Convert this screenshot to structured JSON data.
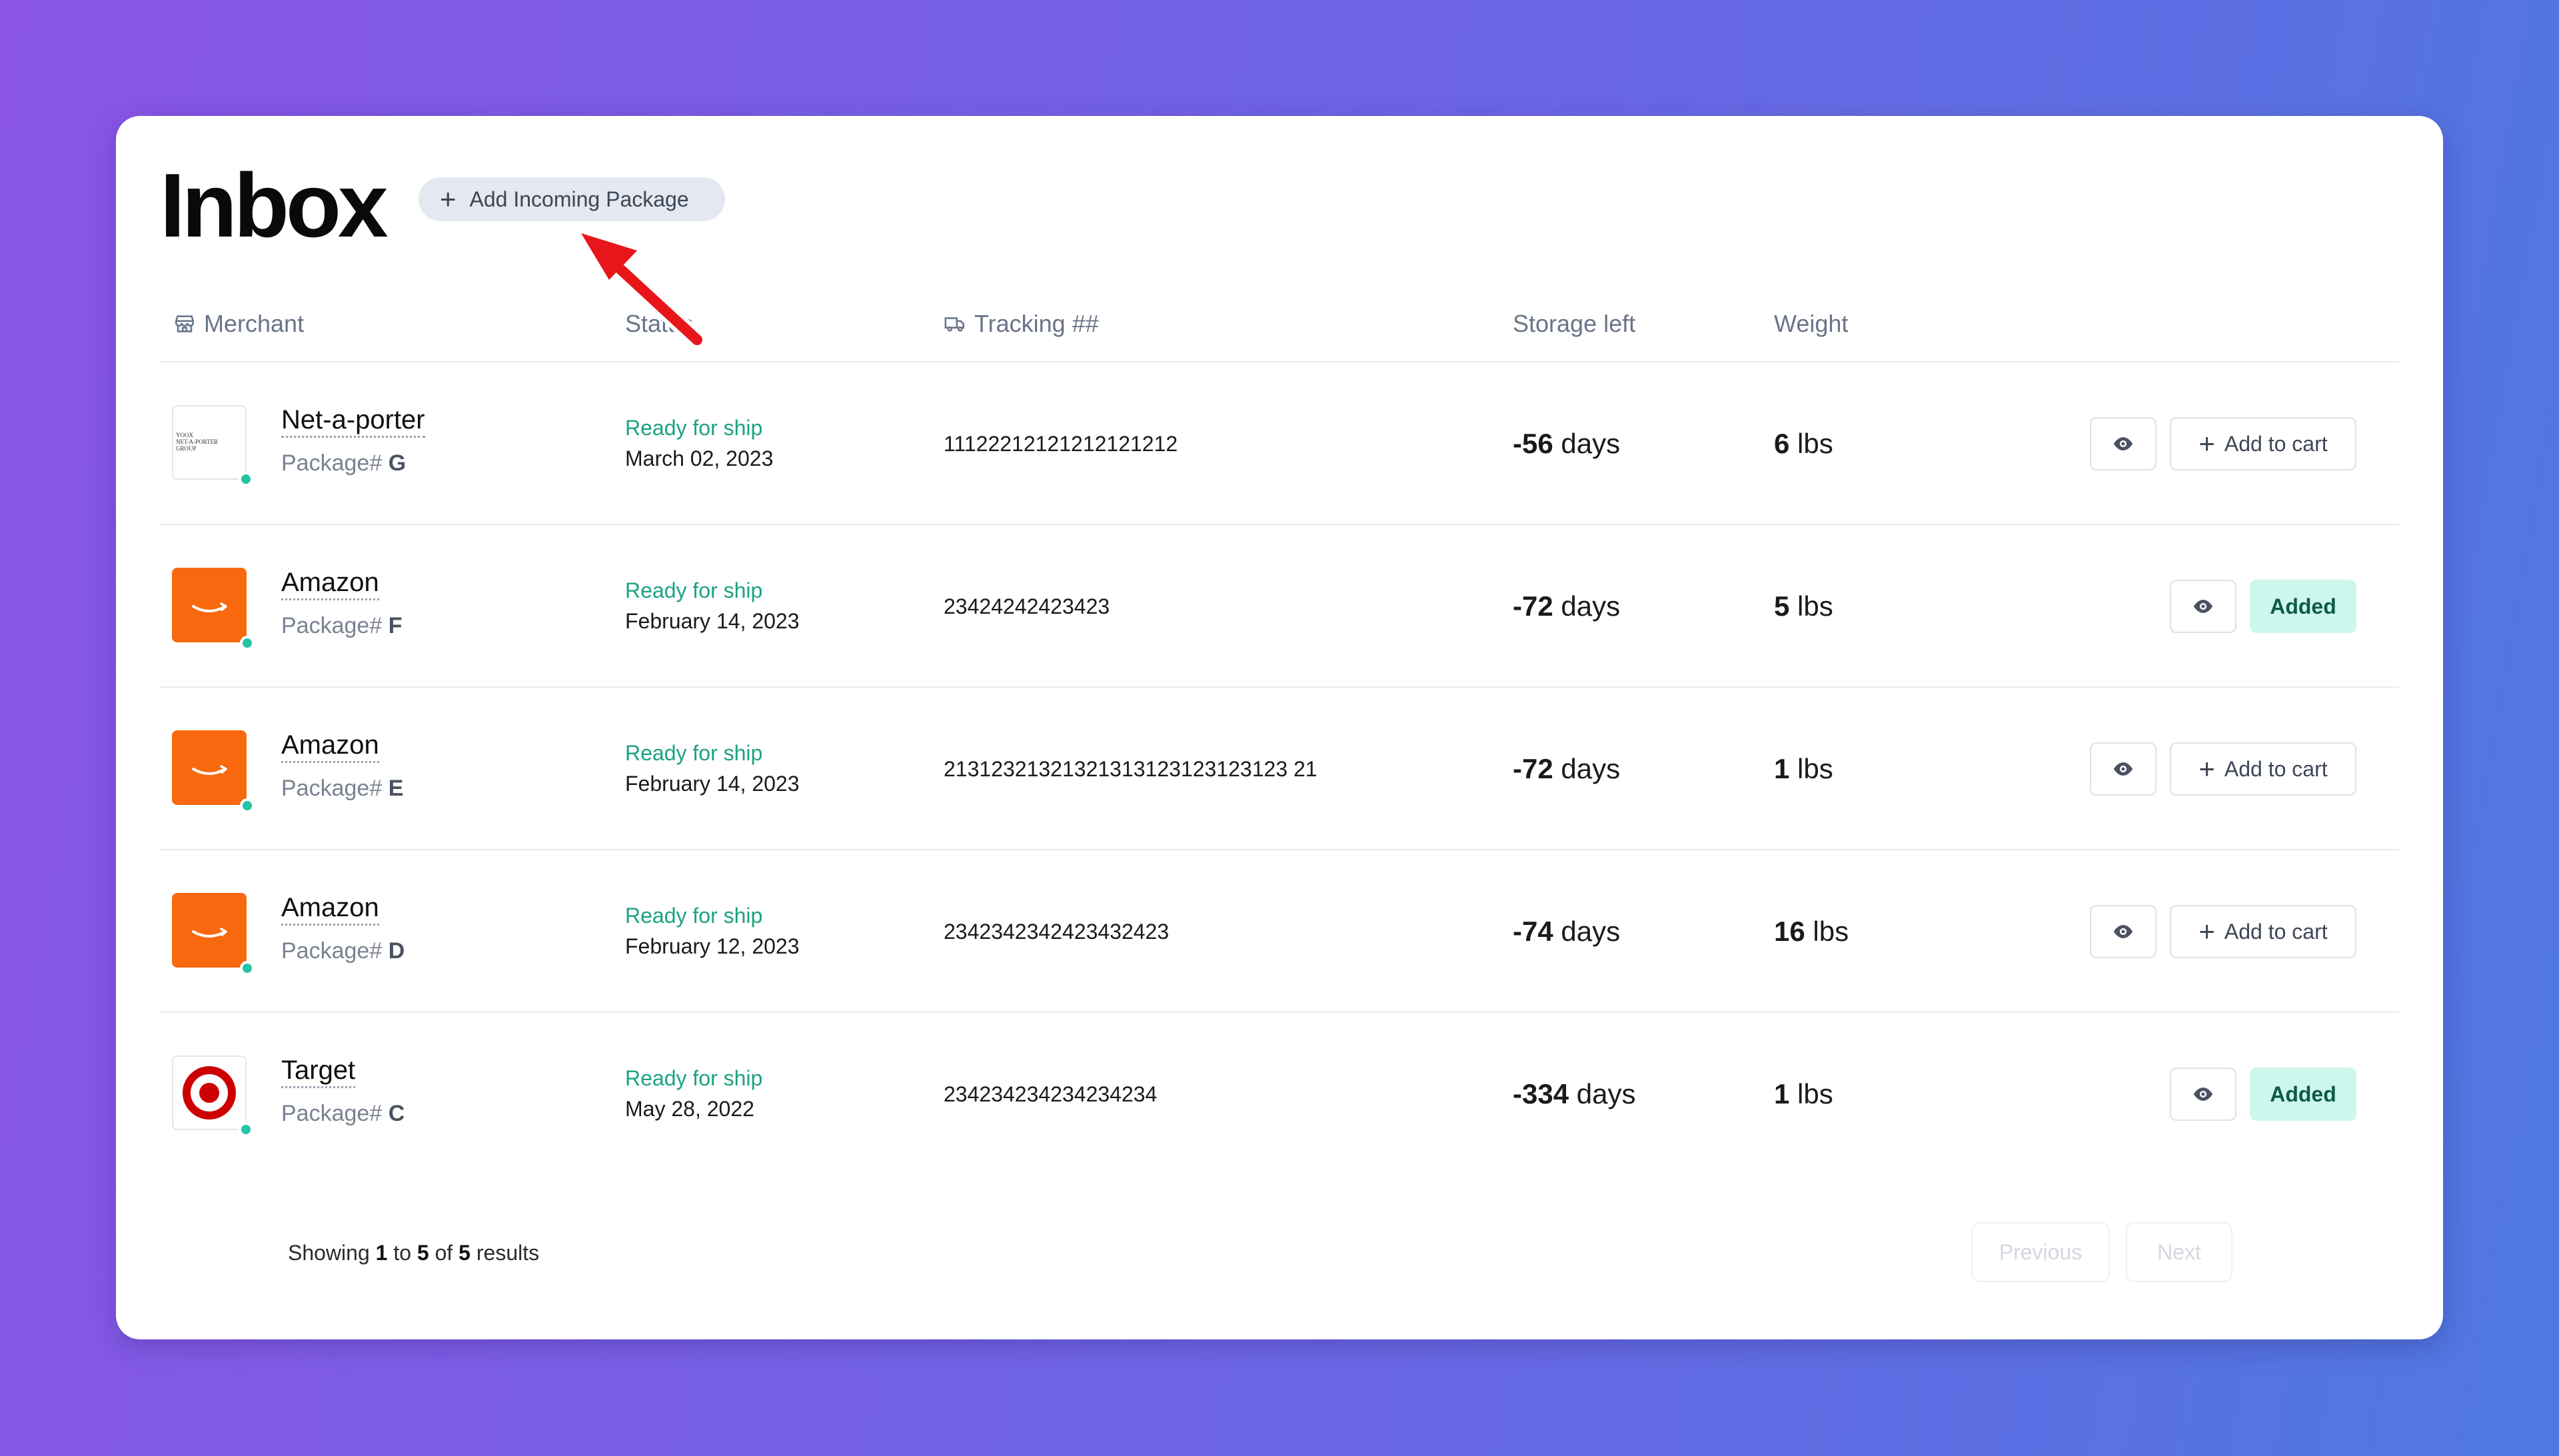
{
  "page": {
    "title": "Inbox",
    "add_incoming_label": "Add Incoming Package"
  },
  "table": {
    "headers": {
      "merchant": "Merchant",
      "status": "Status",
      "tracking": "Tracking ##",
      "storage": "Storage left",
      "weight": "Weight"
    },
    "rows": [
      {
        "merchant": "Net-a-porter",
        "logo": "netaporter-logo",
        "package_prefix": "Package#",
        "package_id": "G",
        "status": "Ready for ship",
        "date": "March 02, 2023",
        "tracking": "11122212121212121212",
        "storage_value": "-56",
        "storage_unit": "days",
        "weight_value": "6",
        "weight_unit": "lbs",
        "action": "add",
        "action_label": "Add to cart"
      },
      {
        "merchant": "Amazon",
        "logo": "amazon-logo",
        "package_prefix": "Package#",
        "package_id": "F",
        "status": "Ready for ship",
        "date": "February 14, 2023",
        "tracking": "23424242423423",
        "storage_value": "-72",
        "storage_unit": "days",
        "weight_value": "5",
        "weight_unit": "lbs",
        "action": "added",
        "action_label": "Added"
      },
      {
        "merchant": "Amazon",
        "logo": "amazon-logo",
        "package_prefix": "Package#",
        "package_id": "E",
        "status": "Ready for ship",
        "date": "February 14, 2023",
        "tracking": "21312321321321313123123123123 21",
        "storage_value": "-72",
        "storage_unit": "days",
        "weight_value": "1",
        "weight_unit": "lbs",
        "action": "add",
        "action_label": "Add to cart"
      },
      {
        "merchant": "Amazon",
        "logo": "amazon-logo",
        "package_prefix": "Package#",
        "package_id": "D",
        "status": "Ready for ship",
        "date": "February 12, 2023",
        "tracking": "2342342342423432423",
        "storage_value": "-74",
        "storage_unit": "days",
        "weight_value": "16",
        "weight_unit": "lbs",
        "action": "add",
        "action_label": "Add to cart"
      },
      {
        "merchant": "Target",
        "logo": "target-logo",
        "package_prefix": "Package#",
        "package_id": "C",
        "status": "Ready for ship",
        "date": "May 28, 2022",
        "tracking": "234234234234234234",
        "storage_value": "-334",
        "storage_unit": "days",
        "weight_value": "1",
        "weight_unit": "lbs",
        "action": "added",
        "action_label": "Added"
      }
    ]
  },
  "footer": {
    "showing": "Showing",
    "from": "1",
    "to_word": "to",
    "to": "5",
    "of_word": "of",
    "total": "5",
    "results_word": "results",
    "previous_label": "Previous",
    "next_label": "Next"
  },
  "netaporter_logo_text": [
    "YOOX",
    "NET-A-PORTER",
    "GROUP"
  ],
  "colors": {
    "status_green": "#1ba382",
    "amazon_orange": "#f8680e",
    "target_red": "#cc0000",
    "added_bg": "#cdf7ec",
    "online_dot": "#24c4a4",
    "annotation_red": "#e8161b"
  }
}
